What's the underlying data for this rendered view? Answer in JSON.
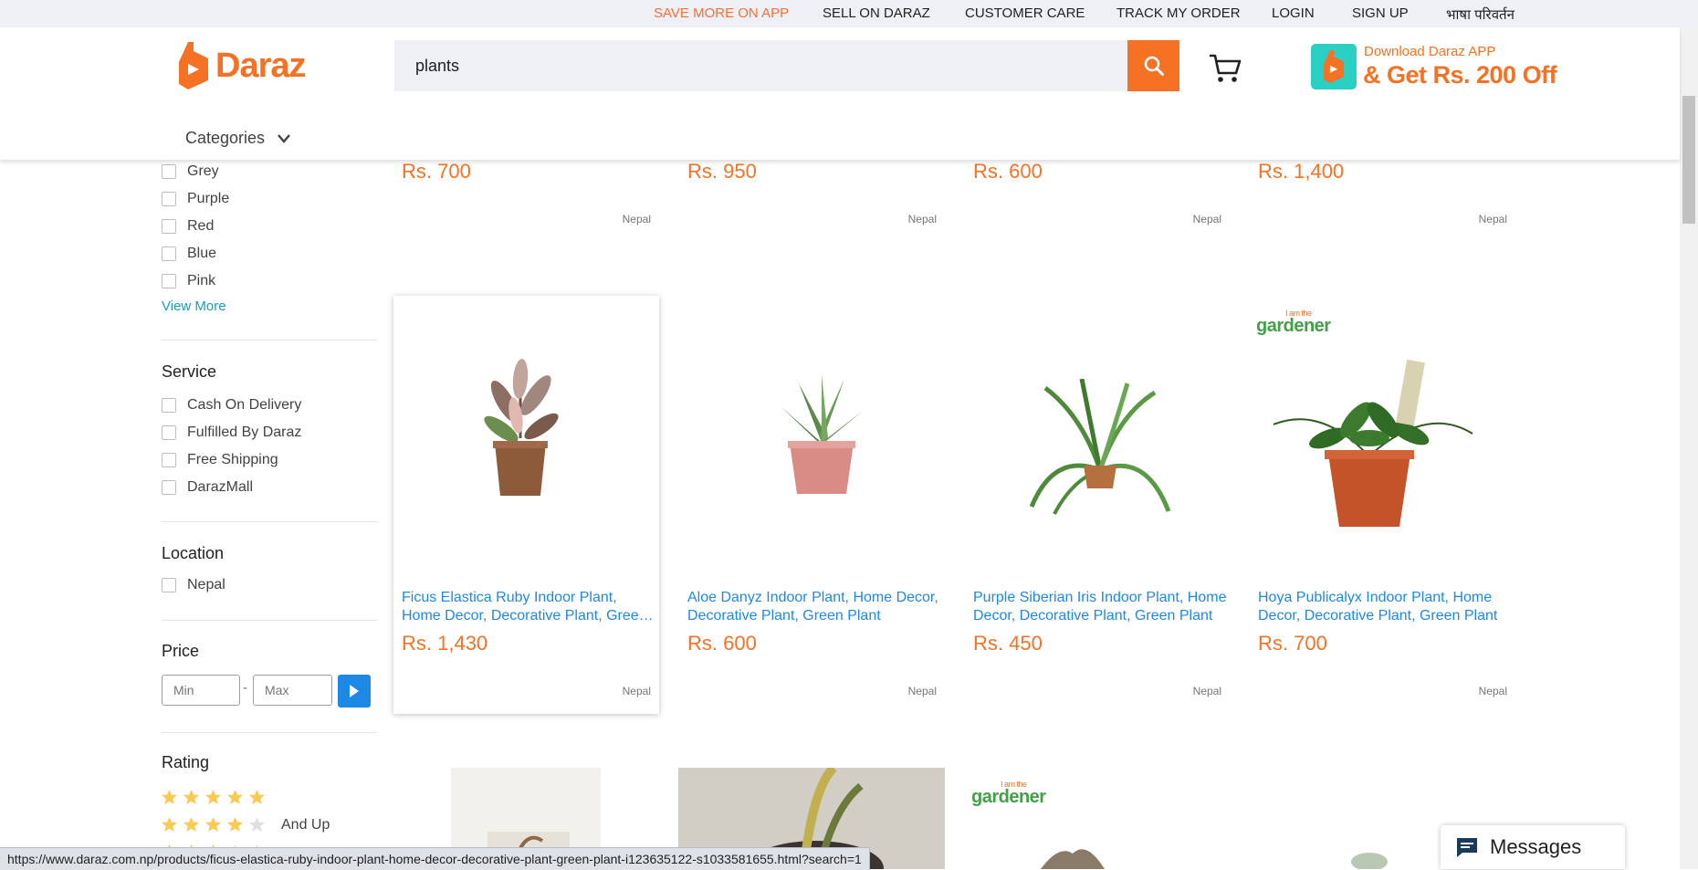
{
  "topbar": {
    "links": [
      "SAVE MORE ON APP",
      "SELL ON DARAZ",
      "CUSTOMER CARE",
      "TRACK MY ORDER",
      "LOGIN",
      "SIGN UP",
      "भाषा परिवर्तन"
    ]
  },
  "header": {
    "logo_text": "Daraz",
    "search_value": "plants",
    "app_promo_line1": "Download Daraz APP",
    "app_promo_line2": "& Get Rs. 200 Off",
    "categories_label": "Categories"
  },
  "filters": {
    "colors": [
      "Grey",
      "Purple",
      "Red",
      "Blue",
      "Pink"
    ],
    "view_more": "View More",
    "service_title": "Service",
    "services": [
      "Cash On Delivery",
      "Fulfilled By Daraz",
      "Free Shipping",
      "DarazMall"
    ],
    "location_title": "Location",
    "locations": [
      "Nepal"
    ],
    "price_title": "Price",
    "price_min_placeholder": "Min",
    "price_max_placeholder": "Max",
    "price_dash": "-",
    "rating_title": "Rating",
    "rating_and_up": "And Up",
    "ratings": [
      5,
      4
    ]
  },
  "products_top_row": [
    {
      "price": "Rs. 700",
      "location": "Nepal"
    },
    {
      "price": "Rs. 950",
      "location": "Nepal"
    },
    {
      "price": "Rs. 600",
      "location": "Nepal"
    },
    {
      "price": "Rs. 1,400",
      "location": "Nepal"
    }
  ],
  "products": [
    {
      "title": "Ficus Elastica Ruby Indoor Plant, Home Decor, Decorative Plant, Green Plant",
      "price": "Rs. 1,430",
      "location": "Nepal"
    },
    {
      "title": "Aloe Danyz Indoor Plant, Home Decor, Decorative Plant, Green Plant",
      "price": "Rs. 600",
      "location": "Nepal"
    },
    {
      "title": "Purple Siberian Iris Indoor Plant, Home Decor, Decorative Plant, Green Plant",
      "price": "Rs. 450",
      "location": "Nepal"
    },
    {
      "title": "Hoya Publicalyx Indoor Plant, Home Decor, Decorative Plant, Green Plant",
      "price": "Rs. 700",
      "location": "Nepal"
    }
  ],
  "gardener_badge": {
    "main": "gardener",
    "small": "I am the"
  },
  "status_url": "https://www.daraz.com.np/products/ficus-elastica-ruby-indoor-plant-home-decor-decorative-plant-green-plant-i123635122-s1033581655.html?search=1",
  "messages_label": "Messages",
  "colors": {
    "brand": "#f57224",
    "link": "#1e88e5",
    "accent_teal": "#1a9cb7"
  }
}
